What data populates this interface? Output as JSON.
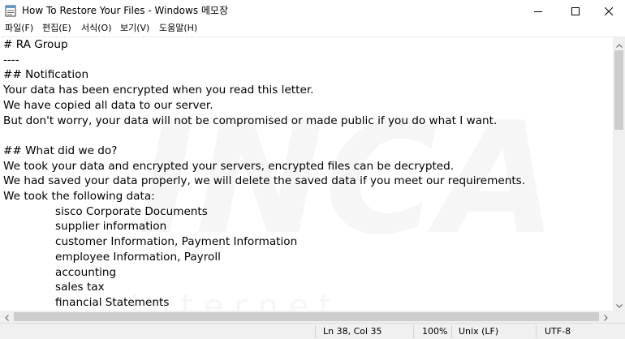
{
  "window": {
    "title": "How To Restore Your Files - Windows 메모장"
  },
  "menu": [
    {
      "label": "파일(F)"
    },
    {
      "label": "편집(E)"
    },
    {
      "label": "서식(O)"
    },
    {
      "label": "보기(V)"
    },
    {
      "label": "도움말(H)"
    }
  ],
  "document": {
    "lines": [
      "# RA Group",
      "----",
      "## Notification",
      "Your data has been encrypted when you read this letter.",
      "We have copied all data to our server.",
      "But don't worry, your data will not be compromised or made public if you do what I want.",
      "",
      "## What did we do?",
      "We took your data and encrypted your servers, encrypted files can be decrypted.",
      "We had saved your data properly, we will delete the saved data if you meet our requirements.",
      "We took the following data:",
      "sisco Corporate Documents",
      "supplier information",
      "customer Information, Payment Information",
      "employee Information, Payroll",
      "accounting",
      "sales tax",
      "financial Statements"
    ]
  },
  "watermark": {
    "logo_text": "INCA",
    "sub_text": "I n t e r n e t"
  },
  "status": {
    "position": "Ln 38, Col 35",
    "zoom": "100%",
    "line_ending": "Unix (LF)",
    "encoding": "UTF-8"
  },
  "icons": {
    "app": "notepad-icon",
    "minimize": "minimize-icon",
    "maximize": "maximize-icon",
    "close": "close-icon"
  }
}
